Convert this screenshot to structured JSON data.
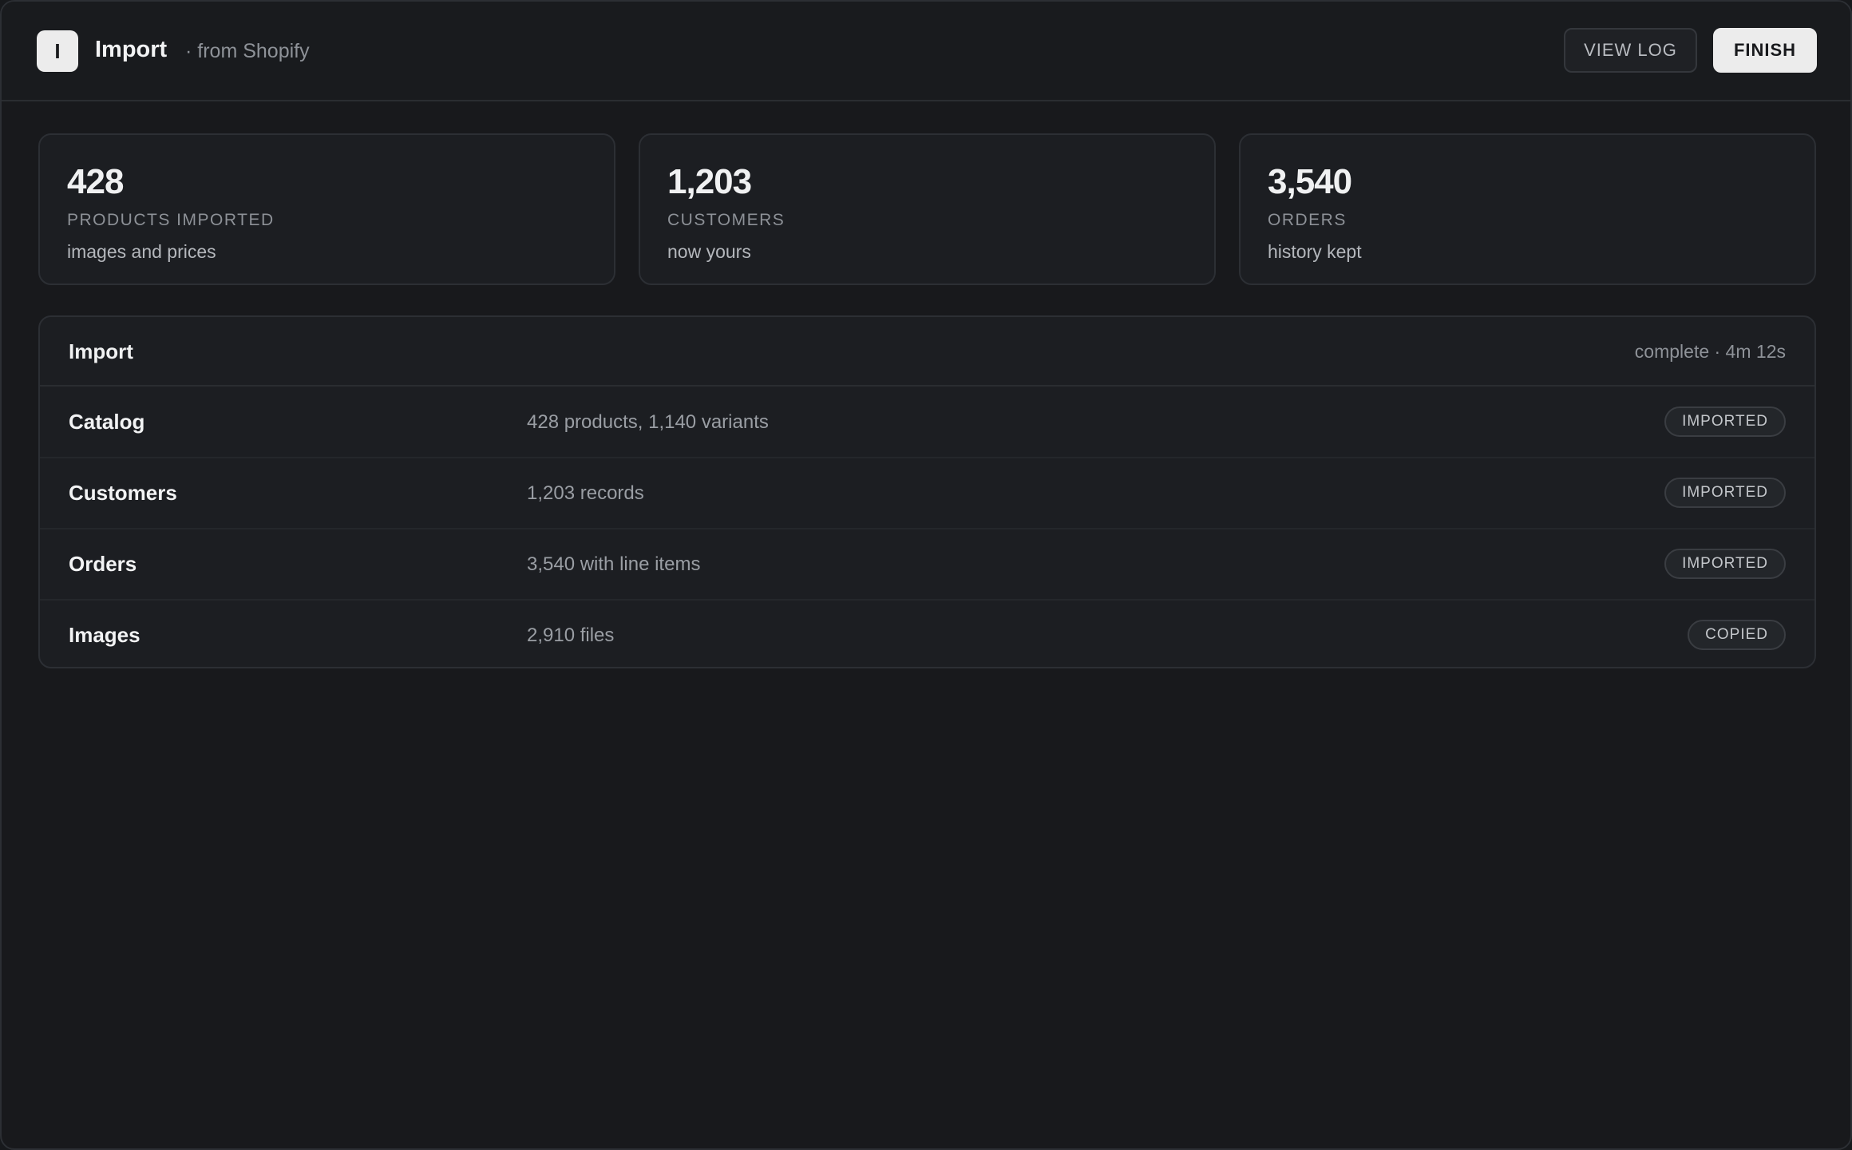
{
  "header": {
    "logo_letter": "I",
    "title": "Import",
    "subtitle": "· from Shopify",
    "view_log_label": "VIEW LOG",
    "finish_label": "FINISH"
  },
  "stats": [
    {
      "value": "428",
      "label": "PRODUCTS IMPORTED",
      "note": "images and prices"
    },
    {
      "value": "1,203",
      "label": "CUSTOMERS",
      "note": "now yours"
    },
    {
      "value": "3,540",
      "label": "ORDERS",
      "note": "history kept"
    }
  ],
  "panel": {
    "title": "Import",
    "status": "complete · 4m 12s",
    "rows": [
      {
        "name": "Catalog",
        "detail": "428 products, 1,140 variants",
        "badge": "IMPORTED"
      },
      {
        "name": "Customers",
        "detail": "1,203 records",
        "badge": "IMPORTED"
      },
      {
        "name": "Orders",
        "detail": "3,540 with line items",
        "badge": "IMPORTED"
      },
      {
        "name": "Images",
        "detail": "2,910 files",
        "badge": "COPIED"
      }
    ]
  }
}
